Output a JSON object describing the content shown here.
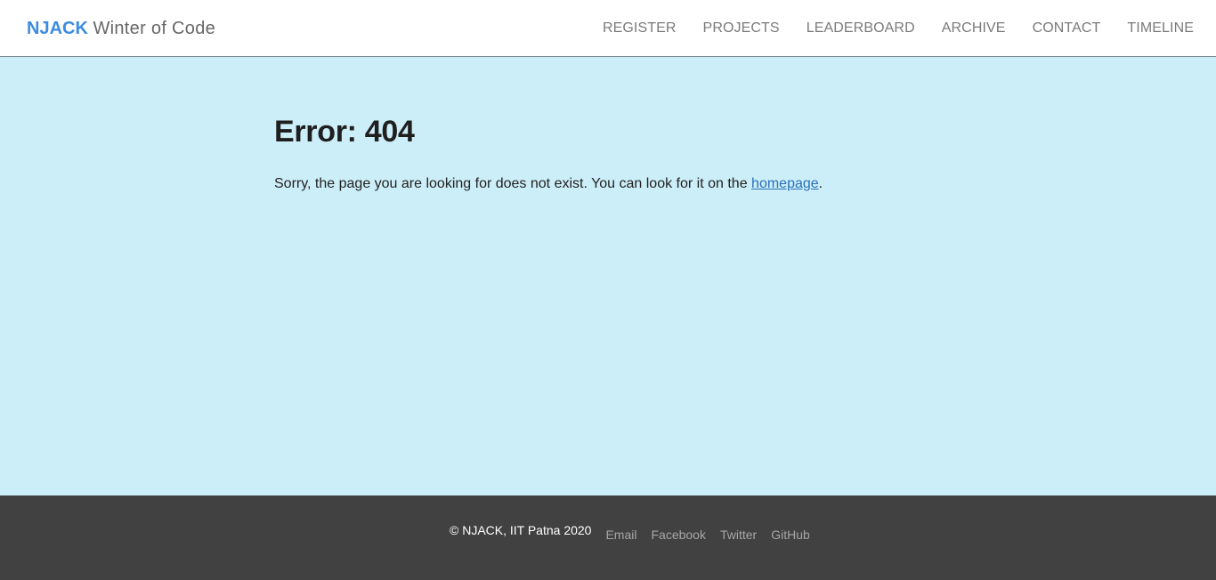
{
  "header": {
    "brand_strong": "NJACK",
    "brand_rest": "Winter of Code",
    "nav": [
      {
        "label": "REGISTER"
      },
      {
        "label": "PROJECTS"
      },
      {
        "label": "LEADERBOARD"
      },
      {
        "label": "ARCHIVE"
      },
      {
        "label": "CONTACT"
      },
      {
        "label": "TIMELINE"
      }
    ]
  },
  "main": {
    "title": "Error: 404",
    "message_prefix": "Sorry, the page you are looking for does not exist. You can look for it on the ",
    "link_text": "homepage",
    "message_suffix": "."
  },
  "footer": {
    "copyright": "© NJACK, IIT Patna 2020",
    "links": [
      {
        "label": "Email"
      },
      {
        "label": "Facebook"
      },
      {
        "label": "Twitter"
      },
      {
        "label": "GitHub"
      }
    ]
  },
  "colors": {
    "brand": "#3c8ce0",
    "page_background": "#cceef8",
    "footer_background": "#414141",
    "link": "#2a70b8"
  }
}
